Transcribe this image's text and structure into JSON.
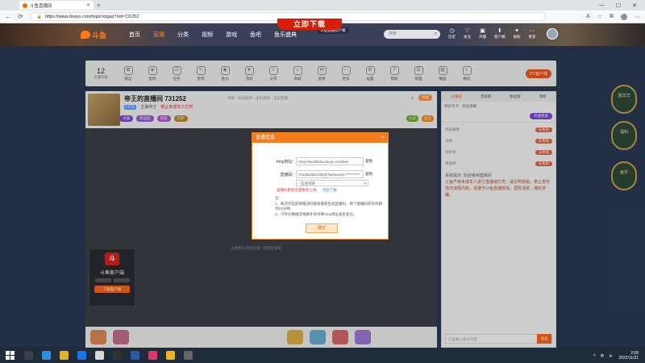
{
  "browser": {
    "tab_title": "斗鱼直播间",
    "url": "https://www.douyu.com/topic/xzgaz?rid=731252",
    "new_tab": "+",
    "win_min": "—",
    "win_max": "☐",
    "win_close": "✕"
  },
  "site": {
    "logo_text": "斗鱼",
    "nav": [
      "首页",
      "直播",
      "分类",
      "视频",
      "游戏",
      "鱼吧",
      "鱼乐盛典"
    ],
    "promo": "立即下载",
    "promo_small": "斗鱼直播客户端",
    "search_placeholder": "搜索",
    "header_icons": [
      "历史",
      "关注",
      "开播",
      "客户端",
      "福利",
      "更多"
    ]
  },
  "toolbar": {
    "level_num": "12",
    "level_text": "主播等级",
    "tools": [
      "粉丝",
      "鱼吧",
      "任务",
      "签到",
      "鱼丸",
      "活动",
      "分享",
      "商城",
      "反馈",
      "更多",
      "设置",
      "帮助",
      "管理",
      "数据",
      "模式"
    ],
    "pc_button": "PC客户端"
  },
  "room": {
    "title": "帝王的直播间 731252",
    "meta": "举报 · 房间类别 · 主机游戏 · 当前直播",
    "level": "LV12",
    "anchor": "主播帝王",
    "warning": "禁止未成年人打赏",
    "badges": [
      "主播",
      "粉丝团",
      "贵族",
      "守护"
    ],
    "report": "举报",
    "share_labels": [
      "分享",
      "关注"
    ],
    "follow_count": "0",
    "video_hint": "主播暂未开始直播 · 请稍后再来"
  },
  "ad": {
    "logo": "斗",
    "title": "斗鱼客户端",
    "button": "下载客户端"
  },
  "panel": {
    "tabs": [
      "主播榜",
      "贵族榜",
      "粉丝榜",
      "周榜"
    ],
    "info": "特权专享 · 贵族弹幕",
    "info_btn": "开通贵族",
    "ranks": [
      "周贡献榜",
      "日榜",
      "守护榜",
      "贵族榜"
    ],
    "rank_tag": "去看看",
    "chat_title": "系统提示: 欢迎来到直播间",
    "chat_text": "斗鱼严禁未成年人进行直播或打赏，请文明观看，禁止发布违法违规内容。请遵守斗鱼直播规范，理性消费，谨防诈骗。",
    "input_placeholder": "这里输入聊天内容",
    "send": "发送"
  },
  "deco": [
    "嘉年华",
    "福利",
    "鱼乐"
  ],
  "modal": {
    "title": "直播信息",
    "close": "×",
    "rtmp_label": "rtmp地址:",
    "rtmp_value": "rtmp://sendfc3a.douyu.com/live",
    "copy1": "复制",
    "code_label": "直播码:",
    "code_value": "731252rEbzJ5fyZ?wsSecret=**********",
    "copy2": "复制",
    "select_value": "- 选择线路 -",
    "warning": "直播码更新后需重新上线",
    "warning_link": "点此了解",
    "notes": [
      "注：",
      "1、每次点击获取推流码都会重新生成直播码，每个直播码的有效期为15分钟。",
      "2、只有切换推流线路才会导致rtmp地址发生变化。"
    ],
    "ok": "确定"
  },
  "taskbar": {
    "time": "2:58",
    "date": "2022/11/21"
  }
}
